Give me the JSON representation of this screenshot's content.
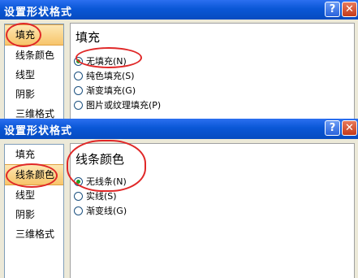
{
  "dialogs": [
    {
      "title": "设置形状格式",
      "help": "?",
      "close": "✕",
      "nav": [
        "填充",
        "线条颜色",
        "线型",
        "阴影",
        "三维格式"
      ],
      "section_title": "填充",
      "options": [
        "无填充(N)",
        "纯色填充(S)",
        "渐变填充(G)",
        "图片或纹理填充(P)"
      ]
    },
    {
      "title": "设置形状格式",
      "help": "?",
      "close": "✕",
      "nav": [
        "填充",
        "线条颜色",
        "线型",
        "阴影",
        "三维格式"
      ],
      "section_title": "线条颜色",
      "options": [
        "无线条(N)",
        "实线(S)",
        "渐变线(G)"
      ]
    }
  ],
  "colors": {
    "annotation": "#e02828",
    "titlebar": "#0a57d6",
    "selection": "#f7c56b"
  }
}
